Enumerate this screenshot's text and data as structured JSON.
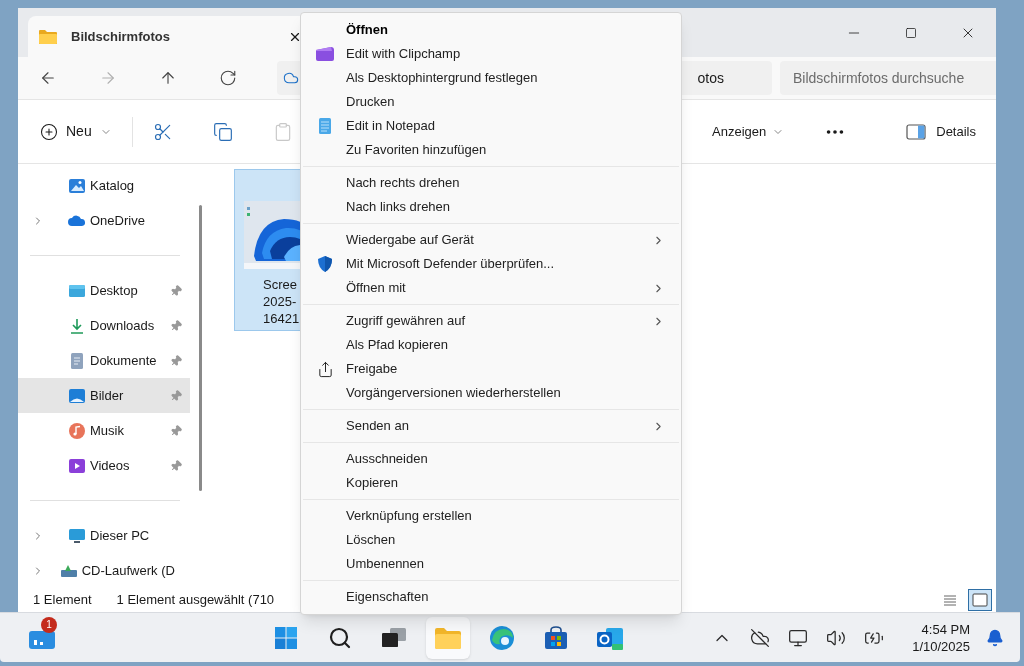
{
  "window": {
    "tab": {
      "title": "Bildschirmfotos",
      "selected": true
    },
    "nav": [
      {
        "kind": "back",
        "disabled": false
      },
      {
        "kind": "forward",
        "disabled": true
      },
      {
        "kind": "up",
        "disabled": false
      },
      {
        "kind": "refresh",
        "disabled": false
      }
    ],
    "address": {
      "visible_text": "otos"
    },
    "search": {
      "placeholder": "Bildschirmfotos durchsuche"
    },
    "toolbar": {
      "new_label": "Neu",
      "actions": [
        {
          "kind": "cut",
          "disabled": false
        },
        {
          "kind": "copy",
          "disabled": false
        },
        {
          "kind": "paste",
          "disabled": true
        }
      ],
      "view_label": "Anzeigen",
      "details_label": "Details"
    },
    "sidebar": {
      "groups": [
        [
          {
            "label": "Katalog",
            "kind": "gallery",
            "expandable": false,
            "pinned": false,
            "selected": false
          },
          {
            "label": "OneDrive",
            "kind": "cloud",
            "expandable": true,
            "pinned": false,
            "selected": false
          }
        ],
        [
          {
            "label": "Desktop",
            "kind": "desktop",
            "expandable": false,
            "pinned": true,
            "selected": false
          },
          {
            "label": "Downloads",
            "kind": "download",
            "expandable": false,
            "pinned": true,
            "selected": false
          },
          {
            "label": "Dokumente",
            "kind": "document",
            "expandable": false,
            "pinned": true,
            "selected": false
          },
          {
            "label": "Bilder",
            "kind": "pictures",
            "expandable": false,
            "pinned": true,
            "selected": true
          },
          {
            "label": "Musik",
            "kind": "music",
            "expandable": false,
            "pinned": true,
            "selected": false
          },
          {
            "label": "Videos",
            "kind": "video",
            "expandable": false,
            "pinned": true,
            "selected": false
          }
        ],
        [
          {
            "label": "Dieser PC",
            "kind": "pc",
            "expandable": true,
            "pinned": false,
            "selected": false
          },
          {
            "label": "CD-Laufwerk (D",
            "kind": "drive",
            "expandable": true,
            "pinned": false,
            "selected": false
          }
        ]
      ]
    },
    "file": {
      "name_lines": [
        "Scree",
        "2025-",
        "16421"
      ],
      "selected": true
    },
    "status_bar": {
      "count": "1 Element",
      "selection": "1 Element ausgewählt (710",
      "views": [
        {
          "kind": "list",
          "selected": false
        },
        {
          "kind": "tiles",
          "selected": true
        }
      ]
    }
  },
  "context_menu": {
    "groups": [
      [
        {
          "label": "Öffnen",
          "default": true,
          "submenu": false
        },
        {
          "label": "Edit with Clipchamp",
          "kind": "clipchamp",
          "default": false,
          "submenu": false
        },
        {
          "label": "Als Desktophintergrund festlegen",
          "default": false,
          "submenu": false
        },
        {
          "label": "Drucken",
          "default": false,
          "submenu": false
        },
        {
          "label": "Edit in Notepad",
          "kind": "notepad",
          "default": false,
          "submenu": false
        },
        {
          "label": "Zu Favoriten hinzufügen",
          "default": false,
          "submenu": false
        }
      ],
      [
        {
          "label": "Nach rechts drehen",
          "default": false,
          "submenu": false
        },
        {
          "label": "Nach links drehen",
          "default": false,
          "submenu": false
        }
      ],
      [
        {
          "label": "Wiedergabe auf Gerät",
          "default": false,
          "submenu": true
        },
        {
          "label": "Mit Microsoft Defender überprüfen...",
          "kind": "shield",
          "default": false,
          "submenu": false
        },
        {
          "label": "Öffnen mit",
          "default": false,
          "submenu": true
        }
      ],
      [
        {
          "label": "Zugriff gewähren auf",
          "default": false,
          "submenu": true
        },
        {
          "label": "Als Pfad kopieren",
          "default": false,
          "submenu": false
        },
        {
          "label": "Freigabe",
          "kind": "share",
          "default": false,
          "submenu": false
        },
        {
          "label": "Vorgängerversionen wiederherstellen",
          "default": false,
          "submenu": false
        }
      ],
      [
        {
          "label": "Senden an",
          "default": false,
          "submenu": true
        }
      ],
      [
        {
          "label": "Ausschneiden",
          "default": false,
          "submenu": false
        },
        {
          "label": "Kopieren",
          "default": false,
          "submenu": false
        }
      ],
      [
        {
          "label": "Verknüpfung erstellen",
          "default": false,
          "submenu": false
        },
        {
          "label": "Löschen",
          "default": false,
          "submenu": false
        },
        {
          "label": "Umbenennen",
          "default": false,
          "submenu": false
        }
      ],
      [
        {
          "label": "Eigenschaften",
          "default": false,
          "submenu": false
        }
      ]
    ]
  },
  "taskbar": {
    "widgets": {
      "badge": "1"
    },
    "apps": [
      {
        "kind": "start",
        "active": false
      },
      {
        "kind": "search",
        "active": false
      },
      {
        "kind": "taskview",
        "active": false
      },
      {
        "kind": "explorer",
        "active": true
      },
      {
        "kind": "edge",
        "active": false
      },
      {
        "kind": "store",
        "active": false
      },
      {
        "kind": "outlook",
        "active": false
      }
    ],
    "tray": [
      {
        "kind": "chevron"
      },
      {
        "kind": "cloud"
      },
      {
        "kind": "network"
      },
      {
        "kind": "volume"
      },
      {
        "kind": "battery"
      }
    ],
    "clock": {
      "time": "4:54 PM",
      "date": "1/10/2025"
    }
  }
}
